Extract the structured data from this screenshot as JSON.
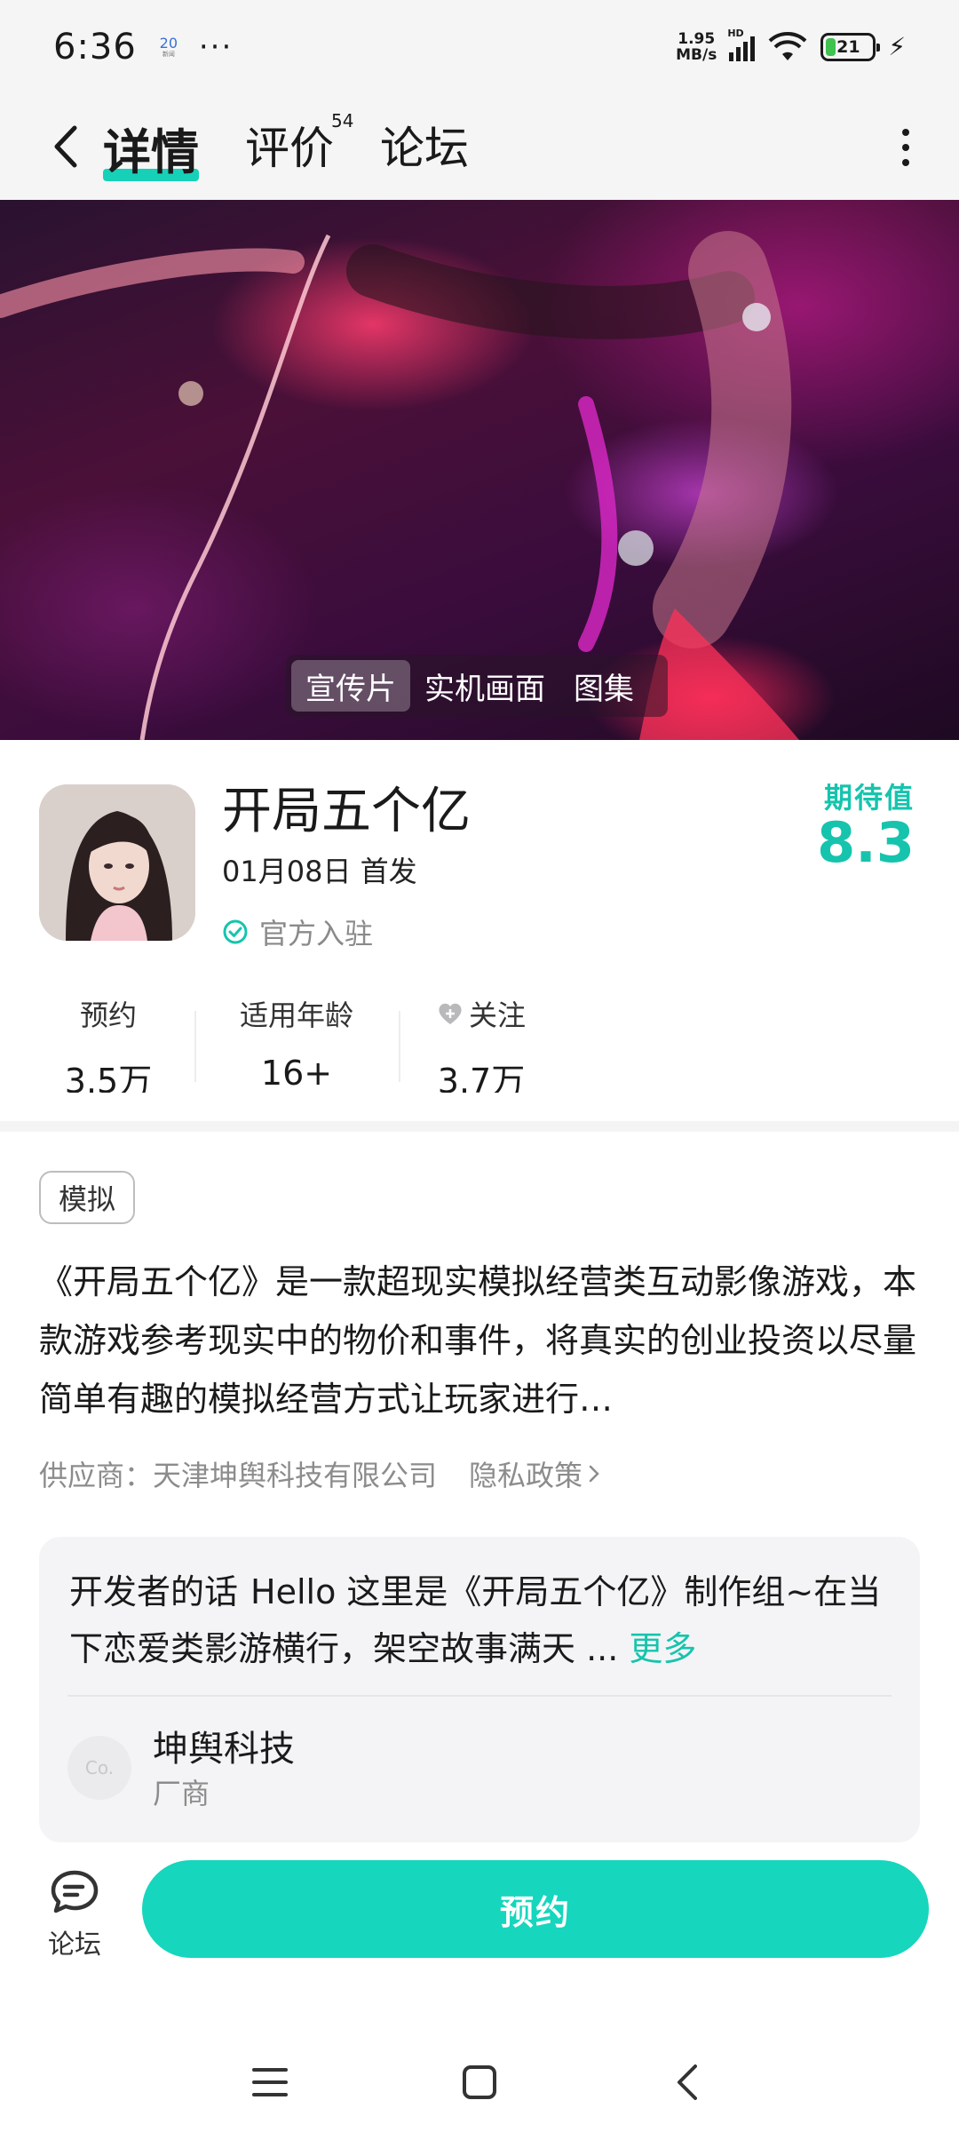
{
  "status_bar": {
    "time": "6:36",
    "notification_badge": "20",
    "notification_sub": "新闻",
    "more_dots": "···",
    "net_speed_value": "1.95",
    "net_speed_unit": "MB/s",
    "hd_label": "HD",
    "battery_level": "21",
    "battery_fraction": 0.21
  },
  "nav": {
    "tabs": [
      {
        "label": "详情",
        "active": true
      },
      {
        "label": "评价"
      },
      {
        "label": "论坛"
      }
    ],
    "review_count": "54"
  },
  "banner": {
    "tabs": [
      {
        "label": "宣传片",
        "active": true
      },
      {
        "label": "实机画面"
      },
      {
        "label": "图集"
      }
    ]
  },
  "game": {
    "title": "开局五个亿",
    "release": "01月08日 首发",
    "official_label": "官方入驻",
    "expectation_label": "期待值",
    "expectation_score": "8.3"
  },
  "stats": [
    {
      "label": "预约",
      "value": "3.5万"
    },
    {
      "label": "适用年龄",
      "value": "16+"
    },
    {
      "label": "关注",
      "value": "3.7万"
    }
  ],
  "genre_tag": "模拟",
  "description": "《开局五个亿》是一款超现实模拟经营类互动影像游戏，本款游戏参考现实中的物价和事件，将真实的创业投资以尽量简单有趣的模拟经营方式让玩家进行…",
  "supplier": "供应商：天津坤舆科技有限公司",
  "privacy_label": "隐私政策",
  "developer": {
    "label": "开发者的话",
    "text": "Hello 这里是《开局五个亿》制作组~在当下恋爱类影游横行，架空故事满天 ...",
    "more_label": "更多",
    "avatar_text": "Co.",
    "name": "坤舆科技",
    "role": "厂商"
  },
  "bottom": {
    "forum_label": "论坛",
    "reserve_label": "预约"
  },
  "colors": {
    "accent": "#16d6bd",
    "accent_text": "#16c4ad",
    "header_bg": "#f5f5f6"
  }
}
